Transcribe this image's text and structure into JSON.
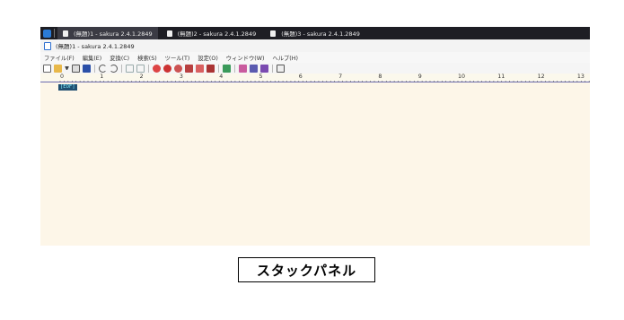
{
  "taskbar": {
    "tasks": [
      {
        "label": "(無題)1 - sakura 2.4.1.2849",
        "active": true
      },
      {
        "label": "(無題)2 - sakura 2.4.1.2849",
        "active": false
      },
      {
        "label": "(無題)3 - sakura 2.4.1.2849",
        "active": false
      }
    ]
  },
  "window": {
    "title": "(無題)1 - sakura 2.4.1.2849"
  },
  "menu": {
    "items": [
      "ファイル(F)",
      "編集(E)",
      "変換(C)",
      "検索(S)",
      "ツール(T)",
      "設定(O)",
      "ウィンドウ(W)",
      "ヘルプ(H)"
    ]
  },
  "toolbar": {
    "icons": [
      "new-file-icon",
      "open-folder-icon",
      "dropdown-arrow-icon",
      "save-icon",
      "save-as-icon",
      "undo-icon",
      "redo-icon",
      "back-icon",
      "forward-icon",
      "search-prev-icon",
      "search-next-icon",
      "search-icon",
      "replace-icon",
      "grep-icon",
      "bookmark-icon",
      "tag-jump-icon",
      "outline-icon",
      "compare-icon",
      "print-icon",
      "settings-icon"
    ]
  },
  "ruler": {
    "numbers": [
      "0",
      "1",
      "2",
      "3",
      "4",
      "5",
      "6",
      "7",
      "8",
      "9",
      "10",
      "11",
      "12",
      "13"
    ]
  },
  "editor": {
    "eof_marker": "[EOF]"
  },
  "caption": {
    "text": "スタックパネル"
  }
}
